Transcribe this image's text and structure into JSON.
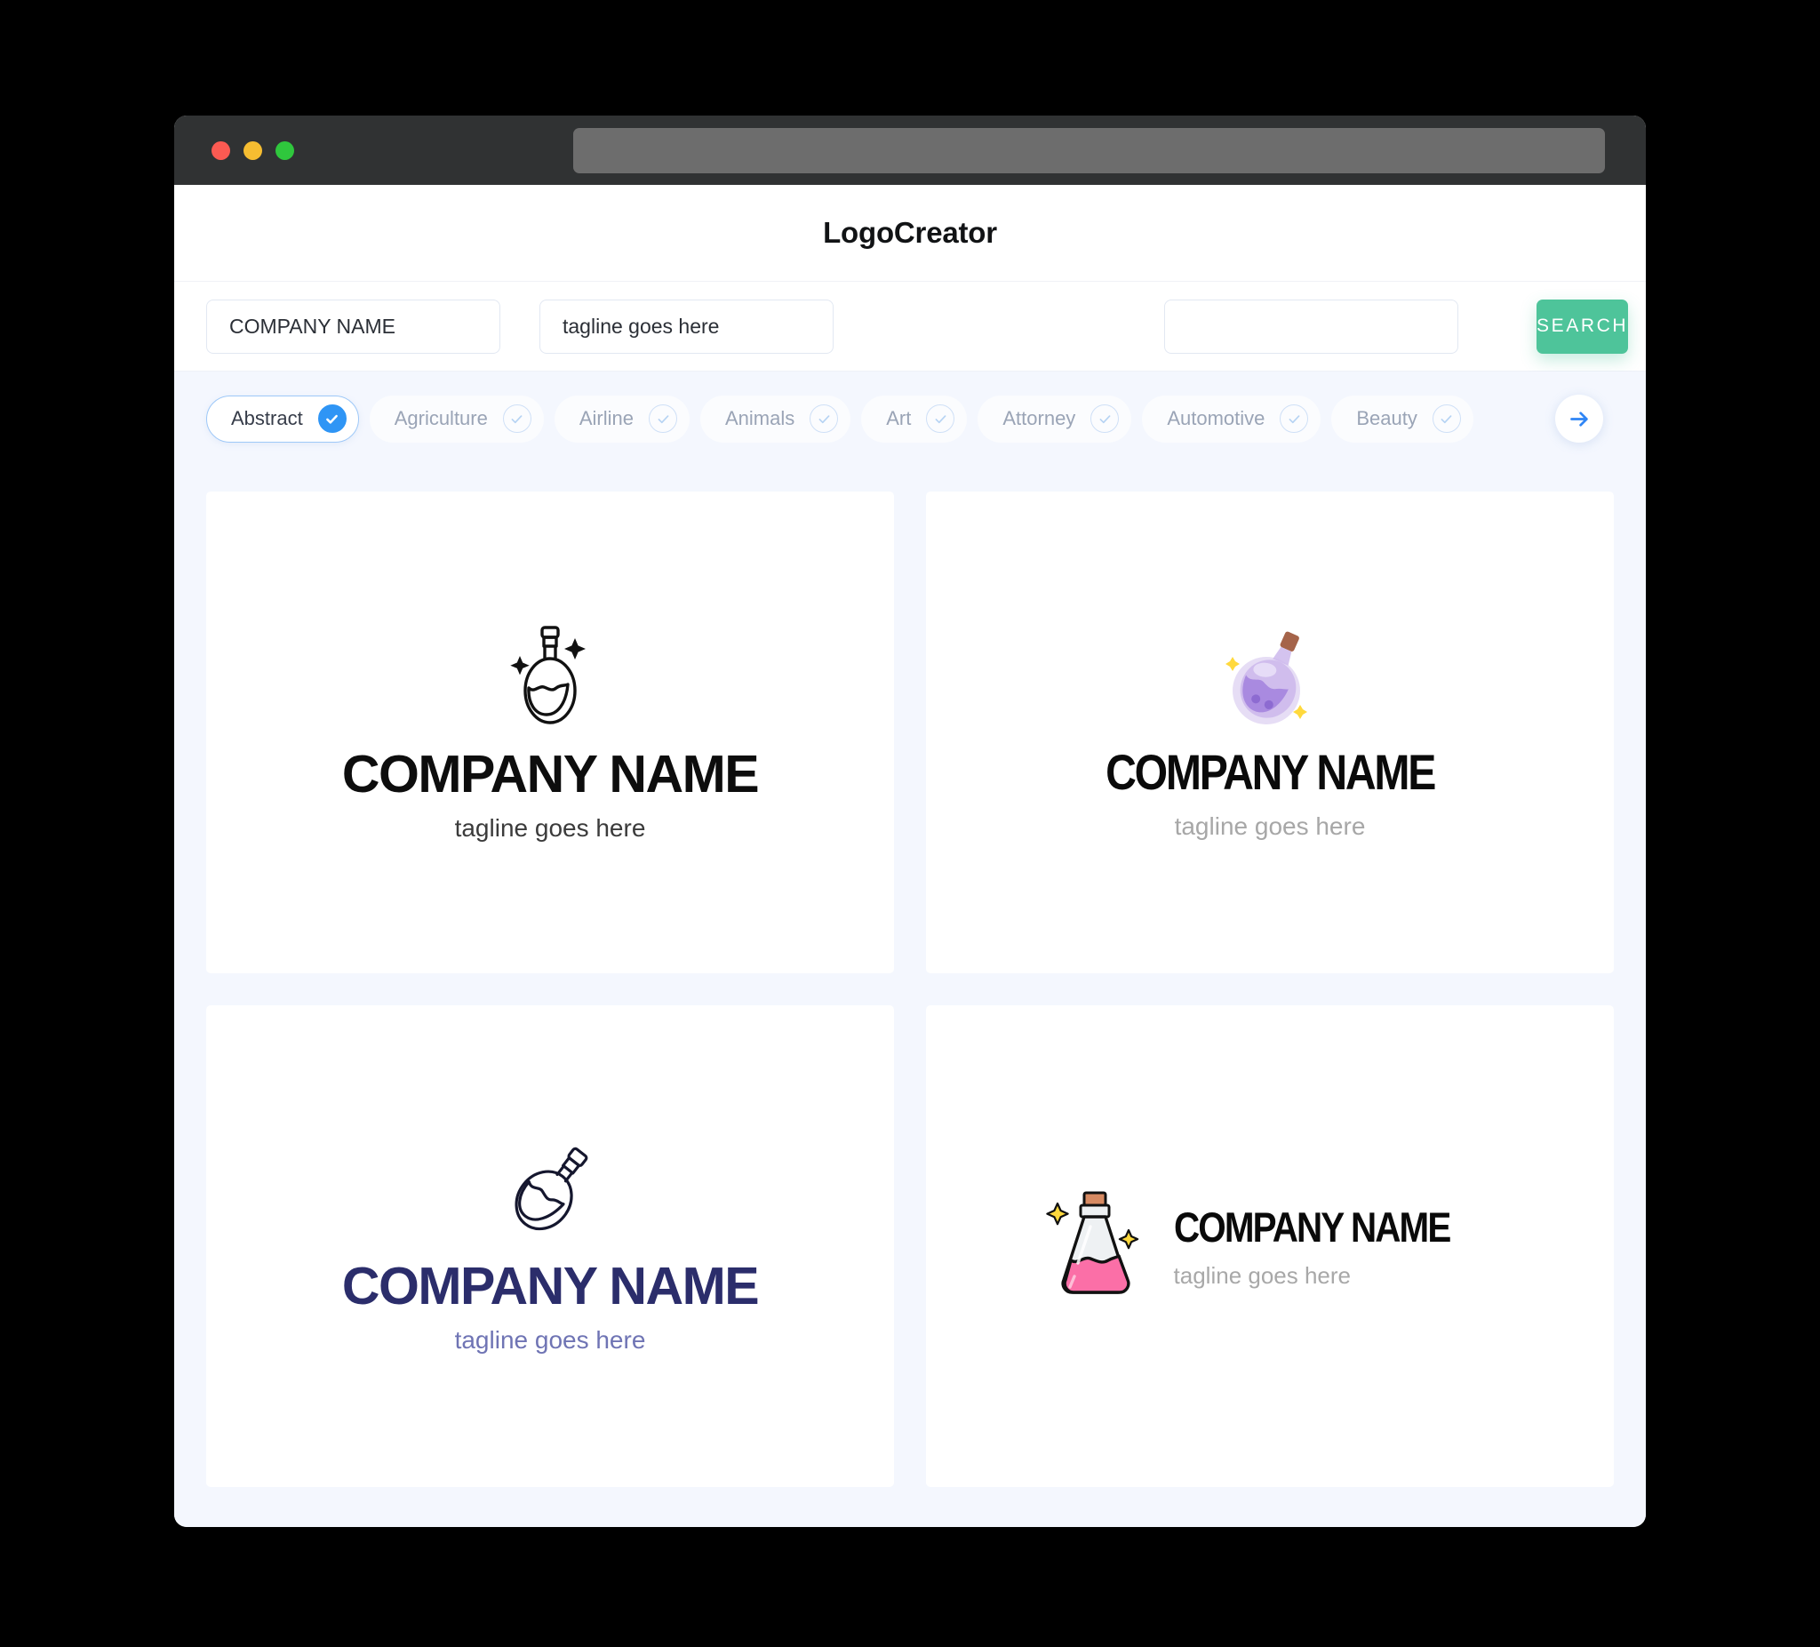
{
  "window": {
    "traffic_lights": [
      "close",
      "minimize",
      "maximize"
    ],
    "address_bar_value": "",
    "address_bar_placeholder": ""
  },
  "header": {
    "brand_title": "LogoCreator"
  },
  "search": {
    "company_value": "COMPANY NAME",
    "company_placeholder": "COMPANY NAME",
    "tagline_value": "tagline goes here",
    "tagline_placeholder": "tagline goes here",
    "extra_value": "",
    "extra_placeholder": "",
    "search_button_label": "SEARCH"
  },
  "categories": {
    "next_icon": "arrow-right-icon",
    "items": [
      {
        "label": "Abstract",
        "selected": true
      },
      {
        "label": "Agriculture",
        "selected": false
      },
      {
        "label": "Airline",
        "selected": false
      },
      {
        "label": "Animals",
        "selected": false
      },
      {
        "label": "Art",
        "selected": false
      },
      {
        "label": "Attorney",
        "selected": false
      },
      {
        "label": "Automotive",
        "selected": false
      },
      {
        "label": "Beauty",
        "selected": false
      }
    ]
  },
  "results": {
    "cards": [
      {
        "icon": "potion-flask-outline-icon",
        "layout": "stacked",
        "name": "COMPANY NAME",
        "tagline": "tagline goes here",
        "name_color": "#0d0d0d",
        "tagline_color": "#3b3b3b"
      },
      {
        "icon": "potion-flask-purple-tilted-icon",
        "layout": "stacked",
        "name": "COMPANY NAME",
        "tagline": "tagline goes here",
        "name_color": "#0a0a0a",
        "tagline_color": "#a7a7a7"
      },
      {
        "icon": "potion-flask-outline-tilted-icon",
        "layout": "stacked",
        "name": "COMPANY NAME",
        "tagline": "tagline goes here",
        "name_color": "#2b2d6b",
        "tagline_color": "#6f74b4"
      },
      {
        "icon": "potion-flask-pink-icon",
        "layout": "horizontal",
        "name": "COMPANY NAME",
        "tagline": "tagline goes here",
        "name_color": "#0a0a0a",
        "tagline_color": "#a8a8a8"
      }
    ]
  },
  "colors": {
    "page_bg": "#f4f7fe",
    "accent_green": "#4ec49a",
    "accent_blue": "#2f95f5",
    "titlebar": "#303233",
    "canvas_black": "#000000"
  }
}
